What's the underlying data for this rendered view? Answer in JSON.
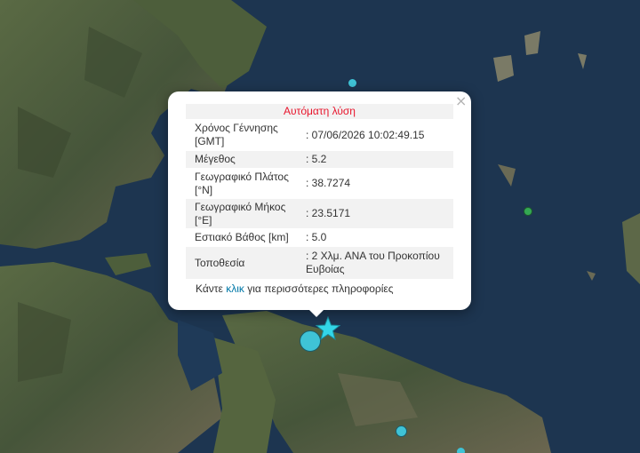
{
  "map": {
    "colors": {
      "sea": "#1d3550",
      "land": "#4a5a3a",
      "marker": "#3fc3d6",
      "marker_green": "#34a853",
      "star": "#33d6e8"
    }
  },
  "markers": [
    {
      "name": "marker-epicenter-circle",
      "color": "#3fc3d6"
    },
    {
      "name": "marker-epicenter-star",
      "icon": "star-icon",
      "color": "#33d6e8"
    },
    {
      "name": "marker-north",
      "color": "#3fc3d6"
    },
    {
      "name": "marker-east-green",
      "color": "#34a853"
    },
    {
      "name": "marker-south-1",
      "color": "#3fc3d6"
    },
    {
      "name": "marker-south-2",
      "color": "#3fc3d6"
    }
  ],
  "popup": {
    "header": "Αυτόματη λύση",
    "close_label": "×",
    "rows": [
      {
        "label": "Χρόνος Γέννησης [GMT]",
        "value": ": 07/06/2026 10:02:49.15"
      },
      {
        "label": "Μέγεθος",
        "value": ": 5.2"
      },
      {
        "label": "Γεωγραφικό Πλάτος [°N]",
        "value": ": 38.7274"
      },
      {
        "label": "Γεωγραφικό Μήκος [°E]",
        "value": ": 23.5171"
      },
      {
        "label": "Εστιακό Βάθος [km]",
        "value": ": 5.0"
      },
      {
        "label": "Τοποθεσία",
        "value": ": 2 Χλμ. ΑΝΑ του Προκοπίου Ευβοίας"
      }
    ],
    "more_prefix": "Κάντε",
    "more_link": "κλικ",
    "more_suffix": "για περισσότερες πληροφορίες"
  }
}
